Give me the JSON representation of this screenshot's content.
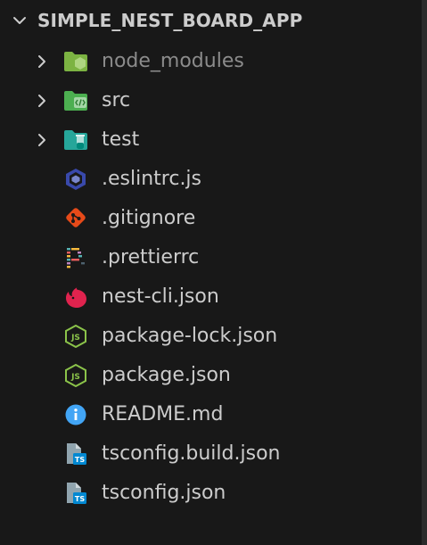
{
  "explorer": {
    "root_folder": "SIMPLE_NEST_BOARD_APP",
    "items": [
      {
        "label": "node_modules",
        "kind": "folder",
        "icon": "node-modules-folder-icon"
      },
      {
        "label": "src",
        "kind": "folder",
        "icon": "src-folder-icon"
      },
      {
        "label": "test",
        "kind": "folder",
        "icon": "test-folder-icon"
      },
      {
        "label": ".eslintrc.js",
        "kind": "file",
        "icon": "eslint-icon"
      },
      {
        "label": ".gitignore",
        "kind": "file",
        "icon": "git-icon"
      },
      {
        "label": ".prettierrc",
        "kind": "file",
        "icon": "prettier-icon"
      },
      {
        "label": "nest-cli.json",
        "kind": "file",
        "icon": "nestjs-icon"
      },
      {
        "label": "package-lock.json",
        "kind": "file",
        "icon": "nodejs-icon"
      },
      {
        "label": "package.json",
        "kind": "file",
        "icon": "nodejs-icon"
      },
      {
        "label": "README.md",
        "kind": "file",
        "icon": "info-icon"
      },
      {
        "label": "tsconfig.build.json",
        "kind": "file",
        "icon": "tsconfig-icon"
      },
      {
        "label": "tsconfig.json",
        "kind": "file",
        "icon": "tsconfig-icon"
      }
    ]
  },
  "colors": {
    "background": "#181818",
    "text": "#cccccc",
    "text_dimmed": "#8b8b8b",
    "folder_green": "#7cb342",
    "folder_teal": "#26a69a",
    "eslint": "#5c6bc0",
    "git": "#e64a19",
    "nest": "#e0234e",
    "nodejs": "#8bc34a",
    "info": "#42a5f5",
    "typescript": "#0288d1"
  }
}
